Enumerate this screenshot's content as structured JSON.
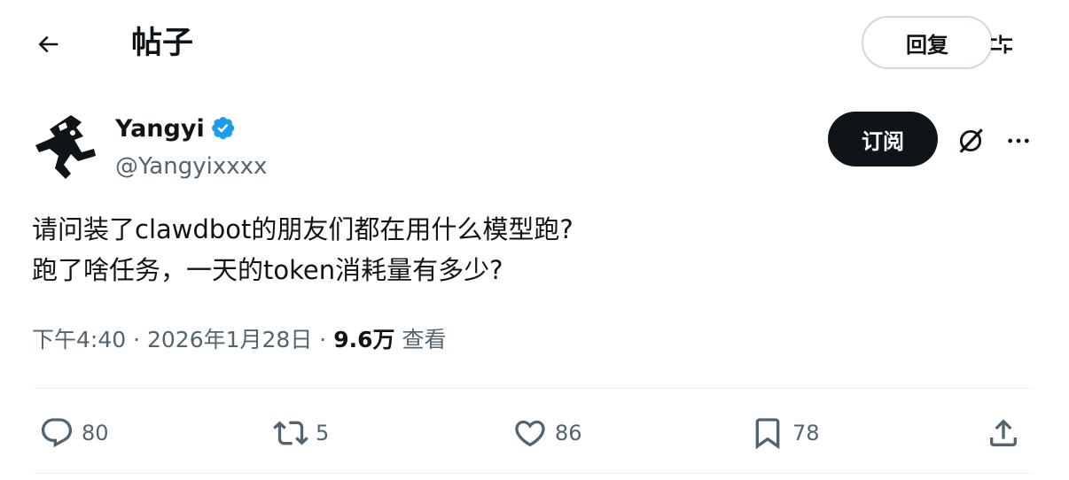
{
  "header": {
    "title": "帖子",
    "reply_label": "回复",
    "icons": {
      "back": "arrow-left-icon",
      "filter": "sliders-icon"
    }
  },
  "author": {
    "display_name": "Yangyi",
    "handle": "@Yangyixxxx",
    "verified": true,
    "verified_color": "#1d9bf0",
    "subscribe_label": "订阅"
  },
  "tweet": {
    "lines": [
      "请问装了clawdbot的朋友们都在用什么模型跑?",
      "跑了啥任务，一天的token消耗量有多少?"
    ]
  },
  "meta": {
    "time": "下午4:40",
    "date": "2026年1月28日",
    "separator": "·",
    "views": "9.6万",
    "views_label": "查看"
  },
  "actions": {
    "replies": "80",
    "retweets": "5",
    "likes": "86",
    "bookmarks": "78"
  },
  "colors": {
    "text_primary": "#0f1419",
    "text_secondary": "#536471",
    "border": "#cfd9de",
    "divider": "#eff3f4",
    "brand_blue": "#1d9bf0"
  }
}
